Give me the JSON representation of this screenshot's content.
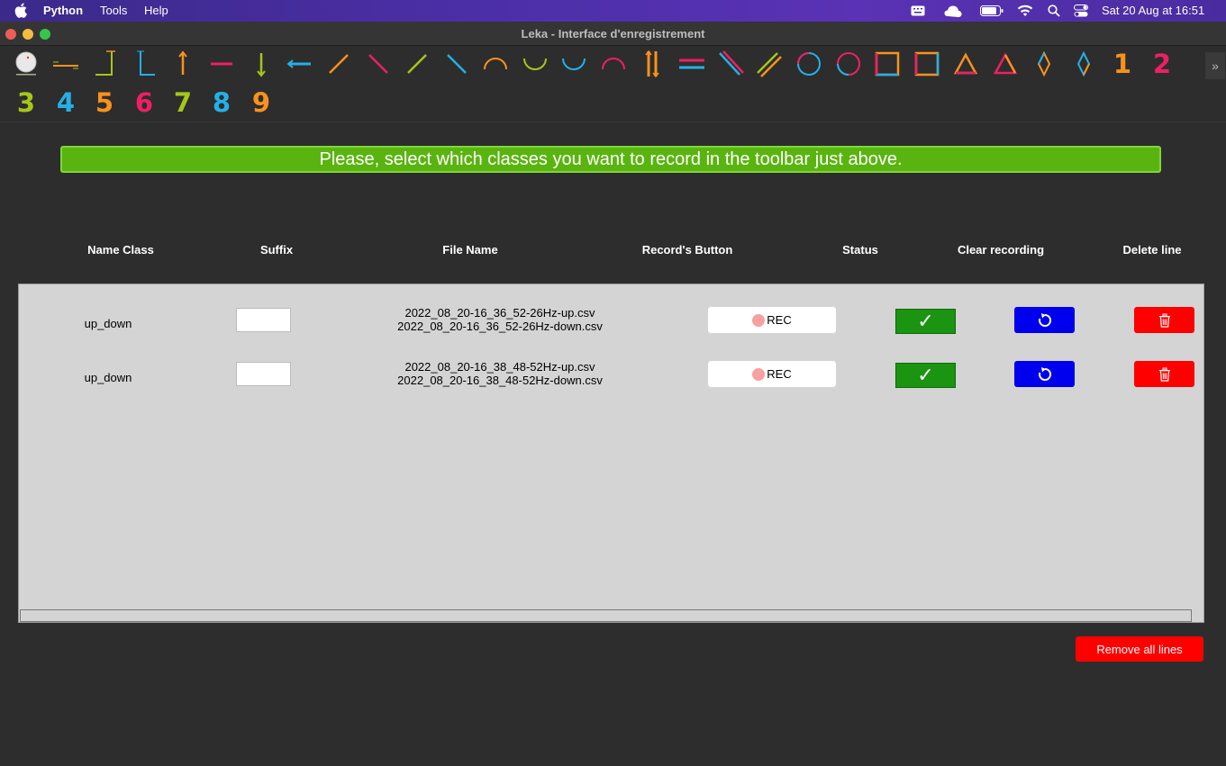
{
  "menubar": {
    "app_name": "Python",
    "menus": [
      "Tools",
      "Help"
    ],
    "clock": "Sat 20 Aug at  16:51",
    "status_icons": [
      "keyboard-icon",
      "weather-icon",
      "battery-icon",
      "wifi-icon",
      "search-icon",
      "control-center-icon"
    ]
  },
  "window": {
    "title": "Leka - Interface d'enregistrement"
  },
  "toolbar": {
    "tools": [
      {
        "name": "robot-icon"
      },
      {
        "name": "line-hold-icon"
      },
      {
        "name": "corner-down-icon"
      },
      {
        "name": "corner-up-icon"
      },
      {
        "name": "arrow-up-icon",
        "color": "#f7921e"
      },
      {
        "name": "dash-icon",
        "color": "#ee1f66"
      },
      {
        "name": "arrow-down-icon",
        "color": "#a6c61a"
      },
      {
        "name": "arrow-left-icon",
        "color": "#25b0e6"
      },
      {
        "name": "diag-up-right-icon",
        "color": "#f7921e"
      },
      {
        "name": "diag-down-right-icon",
        "color": "#ee1f66"
      },
      {
        "name": "diag-up-right-green-icon",
        "color": "#a6c61a"
      },
      {
        "name": "diag-down-right-blue-icon",
        "color": "#25b0e6"
      },
      {
        "name": "arc-top-icon",
        "color": "#f7921e"
      },
      {
        "name": "arc-bottom-icon",
        "color": "#a6c61a"
      },
      {
        "name": "arc-bottom-blue-icon",
        "color": "#25b0e6"
      },
      {
        "name": "arc-top-pink-icon",
        "color": "#ee1f66"
      },
      {
        "name": "up-down-icon",
        "color": "#f7921e"
      },
      {
        "name": "left-right-icon",
        "color": "#ee1f66"
      },
      {
        "name": "diag-double-icon",
        "color": "#25b0e6"
      },
      {
        "name": "diag-double-alt-icon",
        "color": "#a6c61a"
      },
      {
        "name": "circle-blue-icon",
        "color": "#25b0e6"
      },
      {
        "name": "circle-pink-icon",
        "color": "#ee1f66"
      },
      {
        "name": "square-icon",
        "color": "#f7921e"
      },
      {
        "name": "square-alt-icon",
        "color": "#ee1f66"
      },
      {
        "name": "triangle-icon",
        "color": "#f7921e"
      },
      {
        "name": "triangle-alt-icon",
        "color": "#ee1f66"
      },
      {
        "name": "diamond-icon",
        "color": "#f7921e"
      },
      {
        "name": "diamond-alt-icon",
        "color": "#25b0e6"
      }
    ],
    "digits": [
      {
        "label": "1",
        "color": "#f7921e"
      },
      {
        "label": "2",
        "color": "#ee1f66"
      },
      {
        "label": "3",
        "color": "#a6c61a"
      },
      {
        "label": "4",
        "color": "#25b0e6"
      },
      {
        "label": "5",
        "color": "#f7921e"
      },
      {
        "label": "6",
        "color": "#ee1f66"
      },
      {
        "label": "7",
        "color": "#a6c61a"
      },
      {
        "label": "8",
        "color": "#25b0e6"
      },
      {
        "label": "9",
        "color": "#f7921e"
      }
    ],
    "overflow_label": "»"
  },
  "banner": {
    "message": "Please, select which classes you want to record in the toolbar just above."
  },
  "table": {
    "headers": [
      "Name Class",
      "Suffix",
      "File Name",
      "Record's Button",
      "Status",
      "Clear recording",
      "Delete line"
    ],
    "rows": [
      {
        "name_class": "up_down",
        "suffix": "",
        "file_up": "2022_08_20-16_36_52-26Hz-up.csv",
        "file_down": "2022_08_20-16_36_52-26Hz-down.csv",
        "rec_label": "REC",
        "status": "✓"
      },
      {
        "name_class": "up_down",
        "suffix": "",
        "file_up": "2022_08_20-16_38_48-52Hz-up.csv",
        "file_down": "2022_08_20-16_38_48-52Hz-down.csv",
        "rec_label": "REC",
        "status": "✓"
      }
    ]
  },
  "footer": {
    "remove_all_label": "Remove all lines"
  },
  "colors": {
    "banner_green": "#5ab40f",
    "status_green": "#1a9411",
    "clear_blue": "#0000ee",
    "delete_red": "#ff0000"
  }
}
